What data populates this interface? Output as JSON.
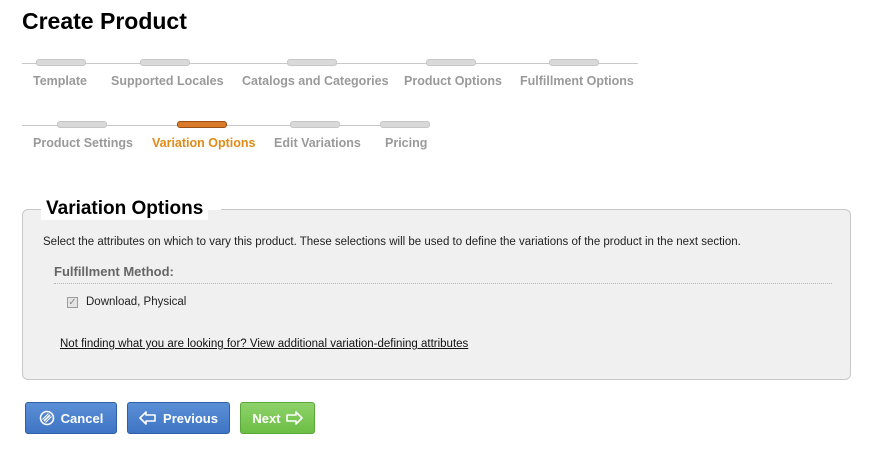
{
  "page": {
    "title": "Create Product"
  },
  "wizard": {
    "row1": [
      {
        "label": "Template",
        "state": "inactive"
      },
      {
        "label": "Supported Locales",
        "state": "inactive"
      },
      {
        "label": "Catalogs and Categories",
        "state": "inactive"
      },
      {
        "label": "Product Options",
        "state": "inactive"
      },
      {
        "label": "Fulfillment Options",
        "state": "inactive"
      }
    ],
    "row2": [
      {
        "label": "Product Settings",
        "state": "inactive"
      },
      {
        "label": "Variation Options",
        "state": "active"
      },
      {
        "label": "Edit Variations",
        "state": "inactive"
      },
      {
        "label": "Pricing",
        "state": "inactive"
      }
    ]
  },
  "panel": {
    "legend": "Variation Options",
    "description": "Select the attributes on which to vary this product. These selections will be used to define the variations of the product in the next section.",
    "group_label": "Fulfillment Method:",
    "option": {
      "label": "Download, Physical",
      "checked": true,
      "disabled": true
    },
    "more_link": "Not finding what you are looking for? View additional variation-defining attributes"
  },
  "buttons": {
    "cancel": "Cancel",
    "previous": "Previous",
    "next": "Next"
  },
  "colors": {
    "active_step": "#e08a17",
    "active_bar": "#d97a2b",
    "inactive_step": "#9a9a9a",
    "button_blue": "#3e74c4",
    "button_green": "#6cbe45"
  }
}
